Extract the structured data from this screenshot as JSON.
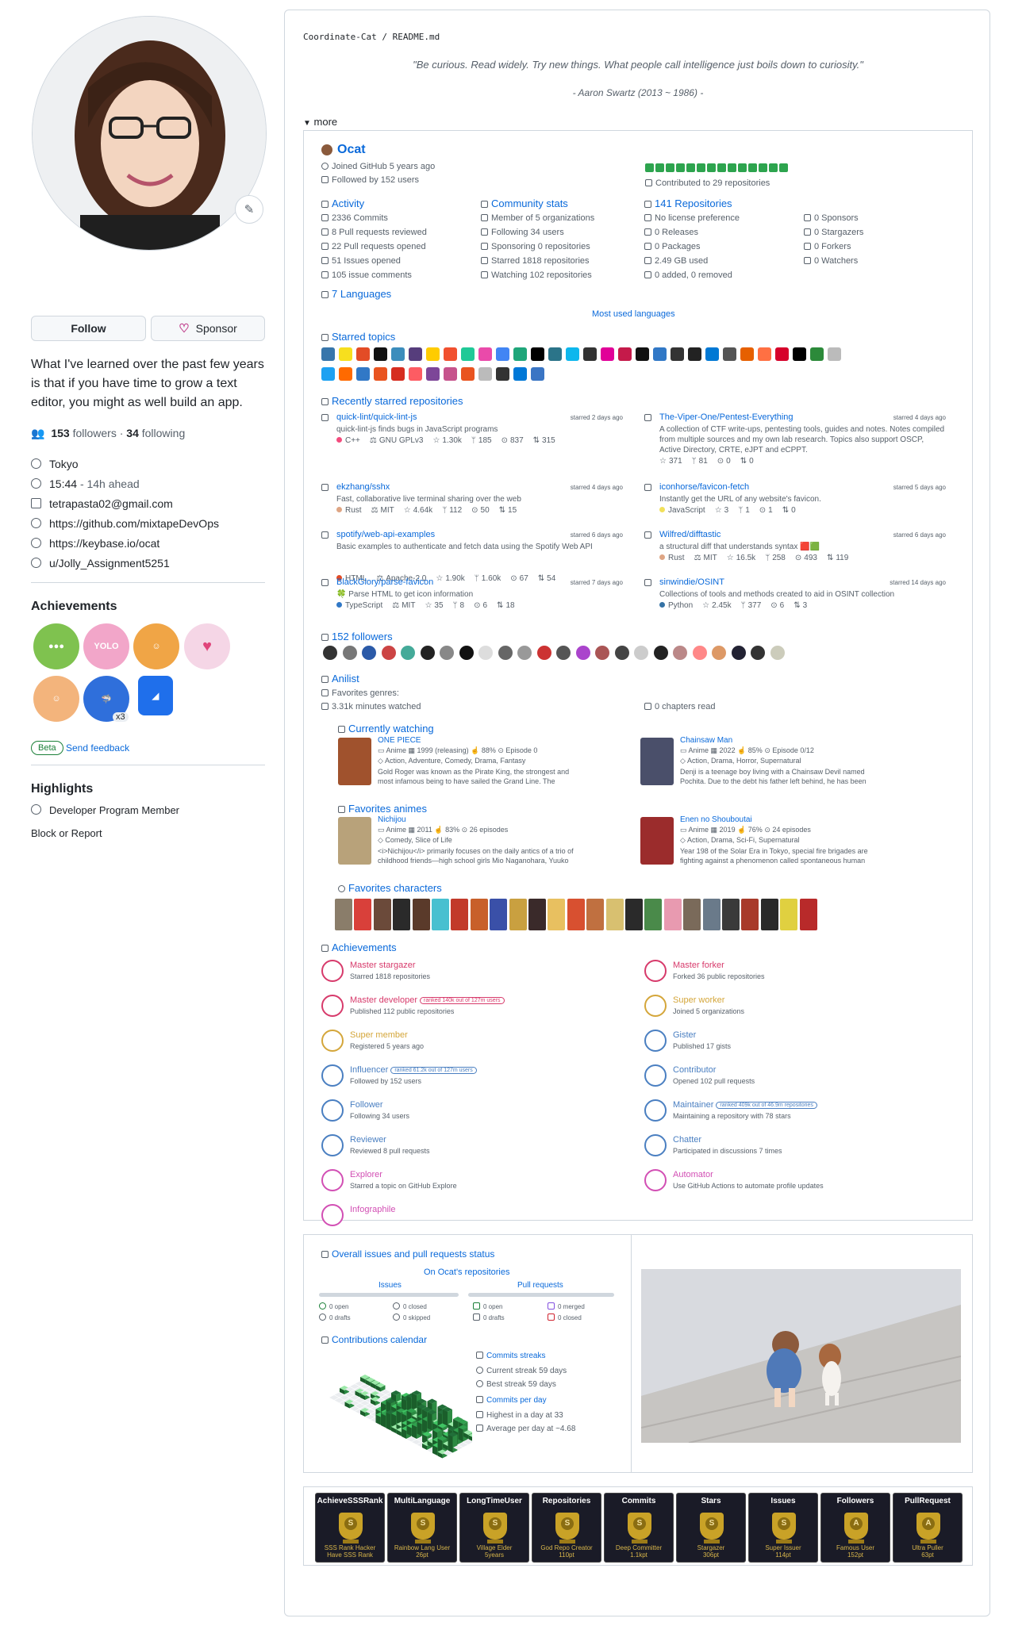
{
  "profile": {
    "follow_label": "Follow",
    "sponsor_label": "Sponsor",
    "bio": "What I've learned over the past few years is that if you have time to grow a text editor, you might as well build an app.",
    "followers_count": "153",
    "followers_word": "followers",
    "following_count": "34",
    "following_word": "following",
    "location": "Tokyo",
    "time": "15:44",
    "time_offset": "- 14h ahead",
    "email": "tetrapasta02@gmail.com",
    "link1": "https://github.com/mixtapeDevOps",
    "link2": "https://keybase.io/ocat",
    "reddit": "u/Jolly_Assignment5251"
  },
  "achievements_side": {
    "title": "Achievements",
    "x3": "x3",
    "beta": "Beta",
    "feedback": "Send feedback"
  },
  "highlights": {
    "title": "Highlights",
    "item": "Developer Program Member",
    "block": "Block or Report"
  },
  "readme": {
    "crumb_user": "Coordinate-Cat",
    "crumb_sep": "/",
    "crumb_file": "README.md",
    "quote": "\"Be curious. Read widely. Try new things. What people call intelligence just boils down to curiosity.\"",
    "quote_author": "- Aaron Swartz (2013 ~ 1986) -",
    "more": "more"
  },
  "metrics": {
    "name": "Ocat",
    "joined": "Joined GitHub 5 years ago",
    "followed_by": "Followed by 152 users",
    "contributed": "Contributed to 29 repositories",
    "activity": {
      "title": "Activity",
      "rows": [
        "2336 Commits",
        "8 Pull requests reviewed",
        "22 Pull requests opened",
        "51 Issues opened",
        "105 issue comments"
      ]
    },
    "community": {
      "title": "Community stats",
      "rows": [
        "Member of 5 organizations",
        "Following 34 users",
        "Sponsoring 0 repositories",
        "Starred 1818 repositories",
        "Watching 102 repositories"
      ]
    },
    "repos": {
      "title": "141 Repositories",
      "rows": [
        "No license preference",
        "0 Releases",
        "0 Packages",
        "2.49 GB used",
        "0 added, 0 removed"
      ]
    },
    "sponsors": {
      "rows": [
        "0 Sponsors",
        "0 Stargazers",
        "0 Forkers",
        "0 Watchers"
      ]
    },
    "languages": "7 Languages",
    "most_used": "Most used languages",
    "starred_topics": "Starred topics",
    "recent_starred": "Recently starred repositories",
    "starred_repos": [
      {
        "name": "quick-lint/quick-lint-js",
        "when": "starred 2 days ago",
        "desc": "quick-lint-js finds bugs in JavaScript programs",
        "lang": "C++",
        "lang_color": "#f34b7d",
        "license": "GNU GPLv3",
        "stars": "1.30k",
        "forks": "185",
        "issues": "837",
        "prs": "315"
      },
      {
        "name": "The-Viper-One/Pentest-Everything",
        "when": "starred 4 days ago",
        "desc": "A collection of CTF write-ups, pentesting tools, guides and notes. Notes compiled from multiple sources and my own lab research. Topics also support OSCP, Active Directory, CRTE, eJPT and eCPPT.",
        "lang": "",
        "lang_color": "",
        "license": "",
        "stars": "371",
        "forks": "81",
        "issues": "0",
        "prs": "0"
      },
      {
        "name": "ekzhang/sshx",
        "when": "starred 4 days ago",
        "desc": "Fast, collaborative live terminal sharing over the web",
        "lang": "Rust",
        "lang_color": "#dea584",
        "license": "MIT",
        "stars": "4.64k",
        "forks": "112",
        "issues": "50",
        "prs": "15"
      },
      {
        "name": "iconhorse/favicon-fetch",
        "when": "starred 5 days ago",
        "desc": "Instantly get the URL of any website's favicon.",
        "lang": "JavaScript",
        "lang_color": "#f1e05a",
        "license": "",
        "stars": "3",
        "forks": "1",
        "issues": "1",
        "prs": "0"
      },
      {
        "name": "spotify/web-api-examples",
        "when": "starred 6 days ago",
        "desc": "Basic examples to authenticate and fetch data using the Spotify Web API",
        "lang": "HTML",
        "lang_color": "#e34c26",
        "license": "Apache-2.0",
        "stars": "1.90k",
        "forks": "1.60k",
        "issues": "67",
        "prs": "54"
      },
      {
        "name": "Wilfred/difftastic",
        "when": "starred 6 days ago",
        "desc": "a structural diff that understands syntax 🟥🟩",
        "lang": "Rust",
        "lang_color": "#dea584",
        "license": "MIT",
        "stars": "16.5k",
        "forks": "258",
        "issues": "493",
        "prs": "119"
      },
      {
        "name": "BlackGlory/parse-favicon",
        "when": "starred 7 days ago",
        "desc": "🍀 Parse HTML to get icon information",
        "lang": "TypeScript",
        "lang_color": "#3178c6",
        "license": "MIT",
        "stars": "35",
        "forks": "8",
        "issues": "6",
        "prs": "18"
      },
      {
        "name": "sinwindie/OSINT",
        "when": "starred 14 days ago",
        "desc": "Collections of tools and methods created to aid in OSINT collection",
        "lang": "Python",
        "lang_color": "#3572a5",
        "license": "",
        "stars": "2.45k",
        "forks": "377",
        "issues": "6",
        "prs": "3"
      }
    ],
    "followers_title": "152 followers",
    "anilist": {
      "title": "Anilist",
      "genres": "Favorites genres:",
      "minutes": "3.31k minutes watched",
      "chapters": "0 chapters read",
      "watching_title": "Currently watching",
      "favorites_title": "Favorites animes",
      "characters_title": "Favorites characters",
      "items": [
        {
          "title": "ONE PIECE",
          "type": "Anime",
          "year": "1999 (releasing)",
          "score": "88%",
          "episodes": "Episode 0",
          "genres": "Action, Adventure, Comedy, Drama, Fantasy",
          "desc": "Gold Roger was known as the Pirate King, the strongest and most infamous being to have sailed the Grand Line. The capture and death ..."
        },
        {
          "title": "Chainsaw Man",
          "type": "Anime",
          "year": "2022",
          "score": "85%",
          "episodes": "Episode 0/12",
          "genres": "Action, Drama, Horror, Supernatural",
          "desc": "Denji is a teenage boy living with a Chainsaw Devil named Pochita. Due to the debt his father left behind, he has been living a rock-bottom lif..."
        },
        {
          "title": "Nichijou",
          "type": "Anime",
          "year": "2011",
          "score": "83%",
          "episodes": "26 episodes",
          "genres": "Comedy, Slice of Life",
          "desc": "<i>Nichijou</i> primarily focuses on the daily antics of a trio of childhood friends—high school girls Mio Naganohara, Yuuko Aioi and..."
        },
        {
          "title": "Enen no Shouboutai",
          "type": "Anime",
          "year": "2019",
          "score": "76%",
          "episodes": "24 episodes",
          "genres": "Action, Drama, Sci-Fi, Supernatural",
          "desc": "Year 198 of the Solar Era in Tokyo, special fire brigades are fighting against a phenomenon called spontaneous human combustion where..."
        }
      ]
    },
    "achievements": {
      "title": "Achievements",
      "items": [
        {
          "name": "Master stargazer",
          "desc": "Starred 1818 repositories",
          "rank": "",
          "color": "#d73a6b"
        },
        {
          "name": "Master forker",
          "desc": "Forked 36 public repositories",
          "rank": "",
          "color": "#d73a6b"
        },
        {
          "name": "Master developer",
          "desc": "Published 112 public repositories",
          "rank": "ranked 140k out of 127m users",
          "color": "#d73a6b"
        },
        {
          "name": "Super worker",
          "desc": "Joined 5 organizations",
          "rank": "",
          "color": "#d4a63a"
        },
        {
          "name": "Super member",
          "desc": "Registered 5 years ago",
          "rank": "",
          "color": "#d4a63a"
        },
        {
          "name": "Gister",
          "desc": "Published 17 gists",
          "rank": "",
          "color": "#4a7fc1"
        },
        {
          "name": "Influencer",
          "desc": "Followed by 152 users",
          "rank": "ranked 61.2k out of 127m users",
          "color": "#4a7fc1"
        },
        {
          "name": "Contributor",
          "desc": "Opened 102 pull requests",
          "rank": "",
          "color": "#4a7fc1"
        },
        {
          "name": "Follower",
          "desc": "Following 34 users",
          "rank": "",
          "color": "#4a7fc1"
        },
        {
          "name": "Maintainer",
          "desc": "Maintaining a repository with 78 stars",
          "rank": "ranked 409k out of 46.9m repositories",
          "color": "#4a7fc1"
        },
        {
          "name": "Reviewer",
          "desc": "Reviewed 8 pull requests",
          "rank": "",
          "color": "#4a7fc1"
        },
        {
          "name": "Chatter",
          "desc": "Participated in discussions 7 times",
          "rank": "",
          "color": "#4a7fc1"
        },
        {
          "name": "Explorer",
          "desc": "Starred a topic on GitHub Explore",
          "rank": "",
          "color": "#d24fb4"
        },
        {
          "name": "Automator",
          "desc": "Use GitHub Actions to automate profile updates",
          "rank": "",
          "color": "#d24fb4"
        },
        {
          "name": "Infographile",
          "desc": "",
          "rank": "",
          "color": "#d24fb4"
        }
      ]
    }
  },
  "status": {
    "title": "Overall issues and pull requests status",
    "subtitle": "On Ocat's repositories",
    "issues_label": "Issues",
    "prs_label": "Pull requests",
    "issues": [
      "0 open",
      "0 drafts",
      "0 closed",
      "0 skipped"
    ],
    "prs": [
      "0 open",
      "0 drafts",
      "0 merged",
      "0 closed"
    ],
    "calendar_title": "Contributions calendar",
    "streaks_title": "Commits streaks",
    "current_streak": "Current streak 59 days",
    "best_streak": "Best streak 59 days",
    "per_day_title": "Commits per day",
    "highest": "Highest in a day at 33",
    "average": "Average per day at ~4.68"
  },
  "trophies": [
    {
      "title": "AchieveSSSRank",
      "rank": "S",
      "sub1": "SSS Rank Hacker",
      "sub2": "Have SSS Rank"
    },
    {
      "title": "MultiLanguage",
      "rank": "S",
      "sub1": "Rainbow Lang User",
      "sub2": "26pt"
    },
    {
      "title": "LongTimeUser",
      "rank": "S",
      "sub1": "Village Elder",
      "sub2": "5years"
    },
    {
      "title": "Repositories",
      "rank": "S",
      "sub1": "God Repo Creator",
      "sub2": "110pt"
    },
    {
      "title": "Commits",
      "rank": "S",
      "sub1": "Deep Committer",
      "sub2": "1.1kpt"
    },
    {
      "title": "Stars",
      "rank": "S",
      "sub1": "Stargazer",
      "sub2": "306pt"
    },
    {
      "title": "Issues",
      "rank": "S",
      "sub1": "Super Issuer",
      "sub2": "114pt"
    },
    {
      "title": "Followers",
      "rank": "A",
      "sub1": "Famous User",
      "sub2": "152pt"
    },
    {
      "title": "PullRequest",
      "rank": "A",
      "sub1": "Ultra Puller",
      "sub2": "63pt"
    }
  ],
  "colors": {
    "accent": "#0969da",
    "contrib_green": "#2da44e",
    "trophy_bg": "#1a1b27",
    "trophy_gold": "#c9a227"
  }
}
